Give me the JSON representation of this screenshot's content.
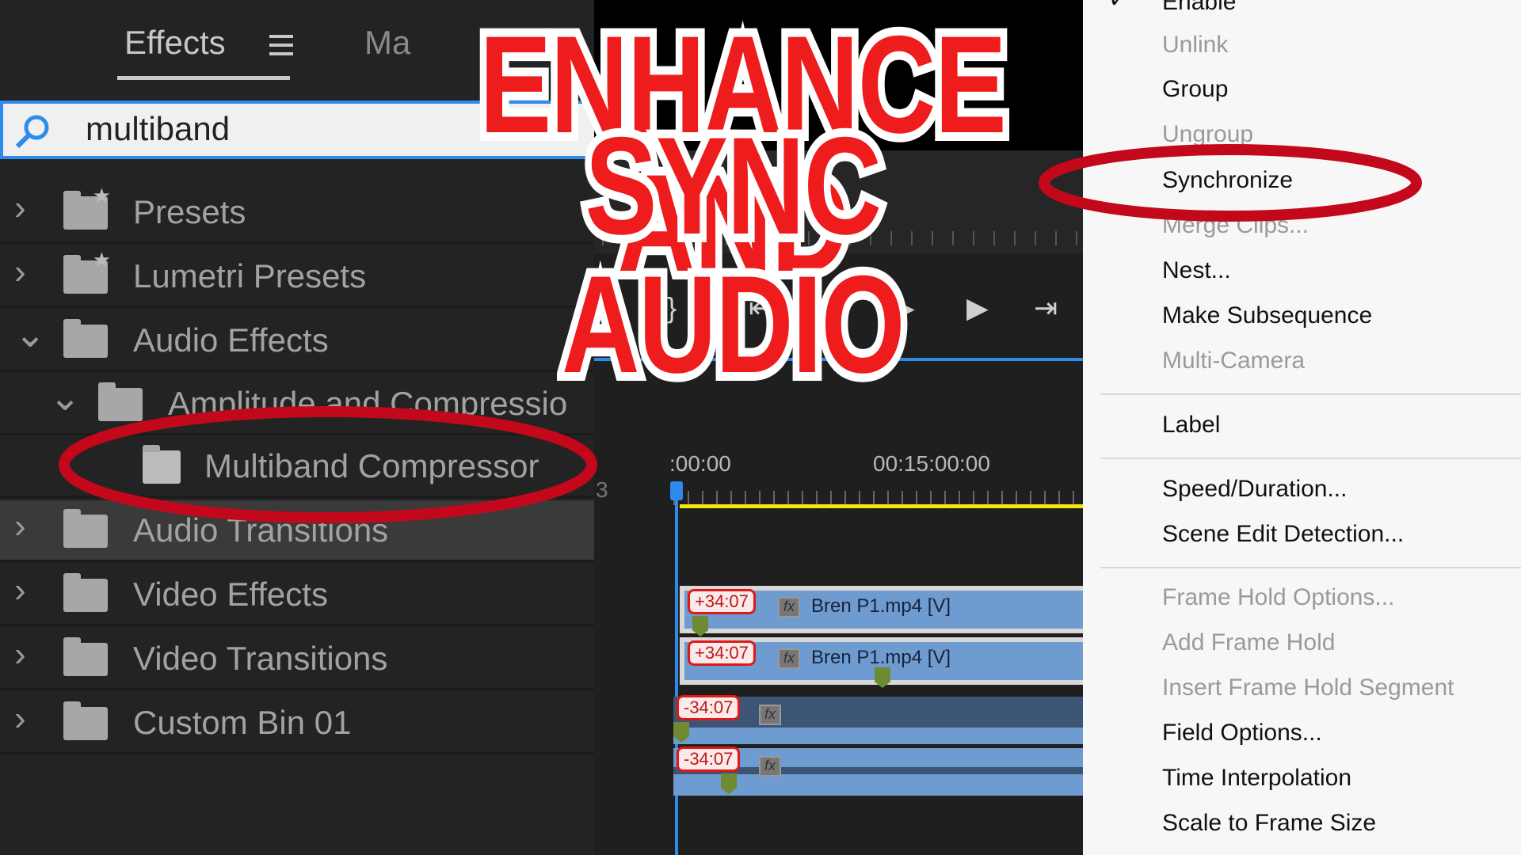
{
  "effects_panel": {
    "tabs": [
      {
        "label": "Effects"
      },
      {
        "label": "Ma"
      }
    ],
    "search": {
      "value": "multiband"
    },
    "tree": [
      {
        "label": "Presets",
        "expanded": false,
        "icon": "preset-folder-icon"
      },
      {
        "label": "Lumetri Presets",
        "expanded": false,
        "icon": "preset-folder-icon"
      },
      {
        "label": "Audio Effects",
        "expanded": true,
        "icon": "folder-icon"
      },
      {
        "label": "Amplitude and Compressio",
        "expanded": true,
        "icon": "folder-icon"
      },
      {
        "label": "Multiband Compressor",
        "icon": "audio-effect-icon"
      },
      {
        "label": "Audio Transitions",
        "expanded": false,
        "icon": "folder-icon",
        "selected": true
      },
      {
        "label": "Video Effects",
        "expanded": false,
        "icon": "folder-icon"
      },
      {
        "label": "Video Transitions",
        "expanded": false,
        "icon": "folder-icon"
      },
      {
        "label": "Custom Bin 01",
        "expanded": false,
        "icon": "folder-icon"
      }
    ]
  },
  "overlay_title": {
    "line1": "ENHANCE AND",
    "line2": "SYNC AUDIO",
    "color": "#ee1c1c"
  },
  "timeline": {
    "timecodes": [
      ":00:00",
      "00:15:00:00"
    ],
    "track_label": "3",
    "clips": [
      {
        "offset": "+34:07",
        "name": "Bren P1.mp4 [V]",
        "fx": "fx"
      },
      {
        "offset": "+34:07",
        "name": "Bren P1.mp4 [V]",
        "fx": "fx"
      },
      {
        "offset": "-34:07",
        "fx": "fx"
      },
      {
        "offset": "-34:07",
        "fx": "fx"
      }
    ]
  },
  "context_menu": {
    "items": [
      {
        "label": "Enable",
        "checked": true,
        "enabled": true
      },
      {
        "label": "Unlink",
        "enabled": false
      },
      {
        "label": "Group",
        "enabled": true
      },
      {
        "label": "Ungroup",
        "enabled": false
      },
      {
        "label": "Synchronize",
        "enabled": true,
        "highlighted_annotation": true
      },
      {
        "label": "Merge Clips...",
        "enabled": false
      },
      {
        "label": "Nest...",
        "enabled": true
      },
      {
        "label": "Make Subsequence",
        "enabled": true
      },
      {
        "label": "Multi-Camera",
        "enabled": false
      },
      {
        "label": "Label",
        "enabled": true
      },
      {
        "label": "Speed/Duration...",
        "enabled": true
      },
      {
        "label": "Scene Edit Detection...",
        "enabled": true
      },
      {
        "label": "Frame Hold Options...",
        "enabled": false
      },
      {
        "label": "Add Frame Hold",
        "enabled": false
      },
      {
        "label": "Insert Frame Hold Segment",
        "enabled": false
      },
      {
        "label": "Field Options...",
        "enabled": true
      },
      {
        "label": "Time Interpolation",
        "enabled": true
      },
      {
        "label": "Scale to Frame Size",
        "enabled": true
      }
    ]
  }
}
